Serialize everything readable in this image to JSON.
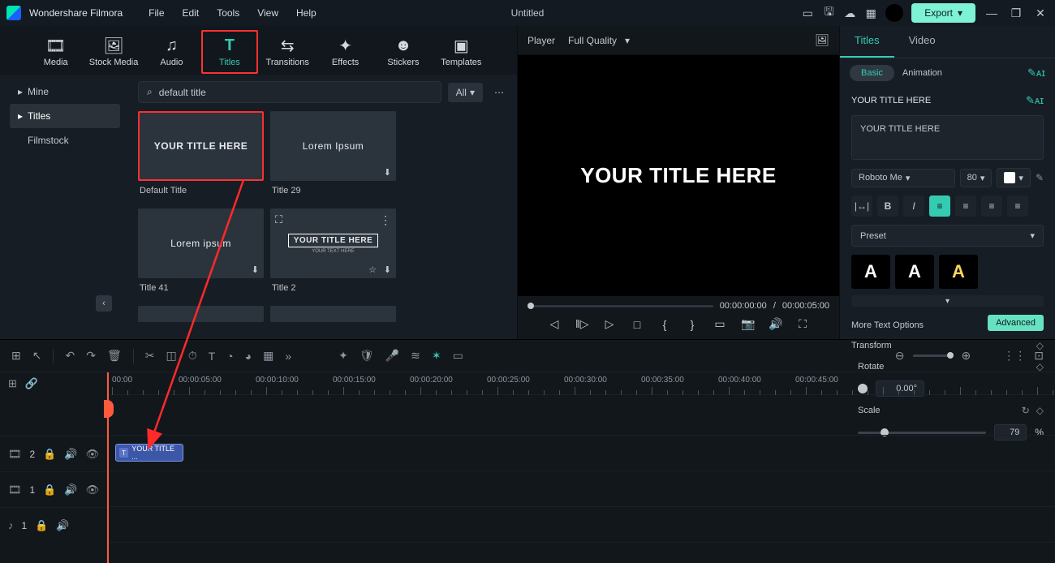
{
  "titlebar": {
    "app_name": "Wondershare Filmora",
    "menu": [
      "File",
      "Edit",
      "Tools",
      "View",
      "Help"
    ],
    "document_title": "Untitled",
    "export_label": "Export"
  },
  "content_tabs": [
    {
      "label": "Media",
      "icon": "media-icon"
    },
    {
      "label": "Stock Media",
      "icon": "stock-icon"
    },
    {
      "label": "Audio",
      "icon": "audio-icon"
    },
    {
      "label": "Titles",
      "icon": "titles-icon",
      "active": true
    },
    {
      "label": "Transitions",
      "icon": "transitions-icon"
    },
    {
      "label": "Effects",
      "icon": "effects-icon"
    },
    {
      "label": "Stickers",
      "icon": "stickers-icon"
    },
    {
      "label": "Templates",
      "icon": "templates-icon"
    }
  ],
  "sidebar": {
    "items": [
      {
        "label": "Mine"
      },
      {
        "label": "Titles",
        "active": true
      },
      {
        "label": "Filmstock"
      }
    ]
  },
  "search": {
    "value": "default title",
    "filter_label": "All"
  },
  "thumbs": [
    {
      "preview": "YOUR TITLE HERE",
      "label": "Default Title",
      "selected": true
    },
    {
      "preview": "Lorem Ipsum",
      "label": "Title 29",
      "download": true
    },
    {
      "preview": "Lorem ipsum",
      "label": "Title 41",
      "download": true
    },
    {
      "preview": "YOUR TITLE HERE",
      "label": "Title 2",
      "download": true,
      "fav": true,
      "expand": true,
      "menu": true,
      "framed": true,
      "subtitle": "YOUR TEXT HERE"
    }
  ],
  "preview": {
    "player_label": "Player",
    "quality_label": "Full Quality",
    "title_text": "YOUR TITLE HERE",
    "time_current": "00:00:00:00",
    "time_total": "00:00:05:00",
    "time_sep": "/"
  },
  "inspector": {
    "tabs": [
      {
        "label": "Titles",
        "active": true
      },
      {
        "label": "Video"
      }
    ],
    "subtabs": {
      "basic": "Basic",
      "animation": "Animation"
    },
    "title_label": "YOUR TITLE HERE",
    "text_value": "YOUR TITLE HERE",
    "font_name": "Roboto Me",
    "font_size": "80",
    "preset_label": "Preset",
    "more_options": "More Text Options",
    "transform": "Transform",
    "rotate_label": "Rotate",
    "rotate_value": "0.00°",
    "scale_label": "Scale",
    "scale_value": "79",
    "scale_unit": "%",
    "advanced_label": "Advanced"
  },
  "timeline": {
    "ruler_labels": [
      "00:00",
      "00:00:05:00",
      "00:00:10:00",
      "00:00:15:00",
      "00:00:20:00",
      "00:00:25:00",
      "00:00:30:00",
      "00:00:35:00",
      "00:00:40:00",
      "00:00:45:00"
    ],
    "tracks": {
      "t2_label": "2",
      "t1_label": "1",
      "a1_label": "1"
    },
    "clip_text": "YOUR TITLE ..."
  }
}
